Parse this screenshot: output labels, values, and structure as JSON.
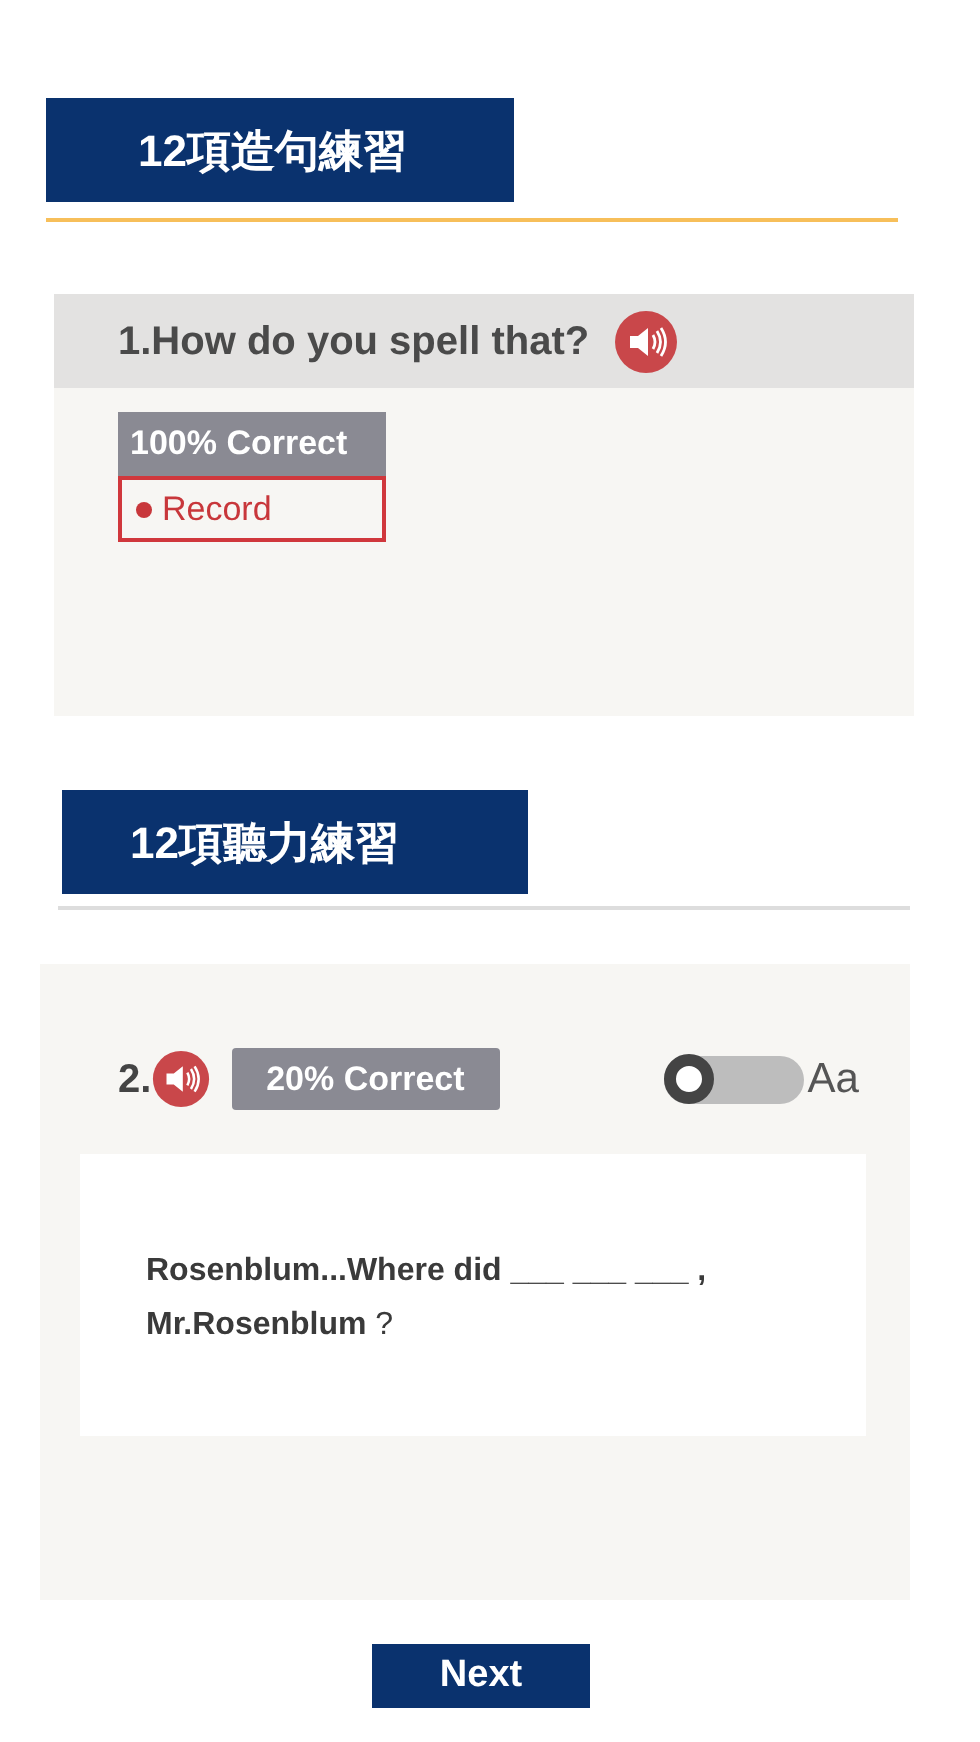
{
  "sections": [
    {
      "title": "12項造句練習",
      "kind": "speaking",
      "question": {
        "prompt": "1.How do you spell that?",
        "score": "100% Correct",
        "record_button": "Record"
      }
    },
    {
      "title": "12項聽力練習",
      "kind": "listening",
      "question": {
        "number": "2.",
        "score": "20% Correct",
        "toggle": {
          "on": false,
          "label": "Aa"
        },
        "sentence": "**Rosenblum...Where did  ___ ___ ___ , Mr.Rosenblum** ?"
      }
    }
  ],
  "next_button": "Next"
}
